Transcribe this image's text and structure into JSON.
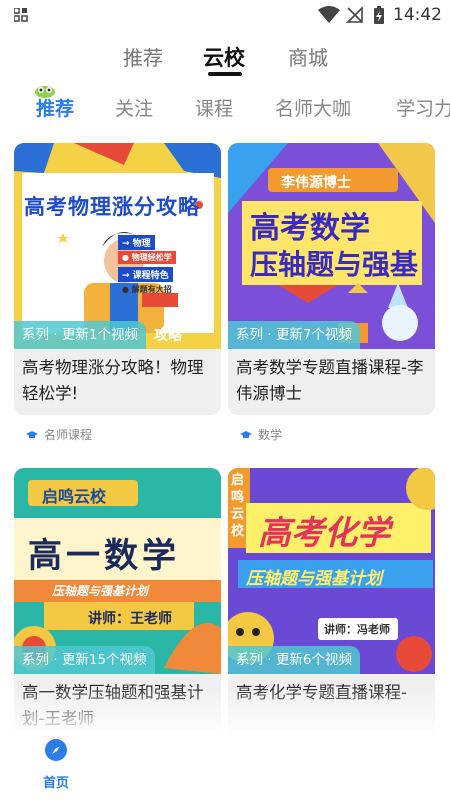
{
  "status_bar": {
    "time": "14:42"
  },
  "top_tabs": [
    "推荐",
    "云校",
    "商城"
  ],
  "sub_tabs": [
    "推荐",
    "关注",
    "课程",
    "名师大咖",
    "学习力"
  ],
  "cards": [
    {
      "badge": "系列 · 更新1个视频",
      "title": "高考物理涨分攻略！物理轻松学!",
      "tag": "名师课程",
      "cover_title": "高考物理涨分攻略",
      "cover_items": [
        "→ 物理",
        "● 物理轻松学",
        "→ 课程特色",
        "● 解题有大招"
      ],
      "cover_extra": "攻略"
    },
    {
      "badge": "系列 · 更新7个视频",
      "title": "高考数学专题直播课程-李伟源博士",
      "tag": "数学",
      "cover_banner": "李伟源博士",
      "cover_line1": "高考数学",
      "cover_line2": "压轴题与强基"
    },
    {
      "badge": "系列 · 更新15个视频",
      "title": "高一数学压轴题和强基计划-王老师",
      "cover_banner": "启鸣云校",
      "cover_main": "高一数学",
      "cover_sub": "压轴题与强基计划",
      "cover_teacher": "讲师：王老师"
    },
    {
      "badge": "系列 · 更新6个视频",
      "title": "高考化学专题直播课程-",
      "cover_side": "启鸣云校",
      "cover_line1": "高考化学",
      "cover_line2": "压轴题与强基计划",
      "cover_teacher": "讲师：冯老师"
    }
  ],
  "bottom_nav": {
    "home_label": "首页"
  },
  "colors": {
    "accent": "#2b7de9",
    "badge": "#50c8d2"
  }
}
